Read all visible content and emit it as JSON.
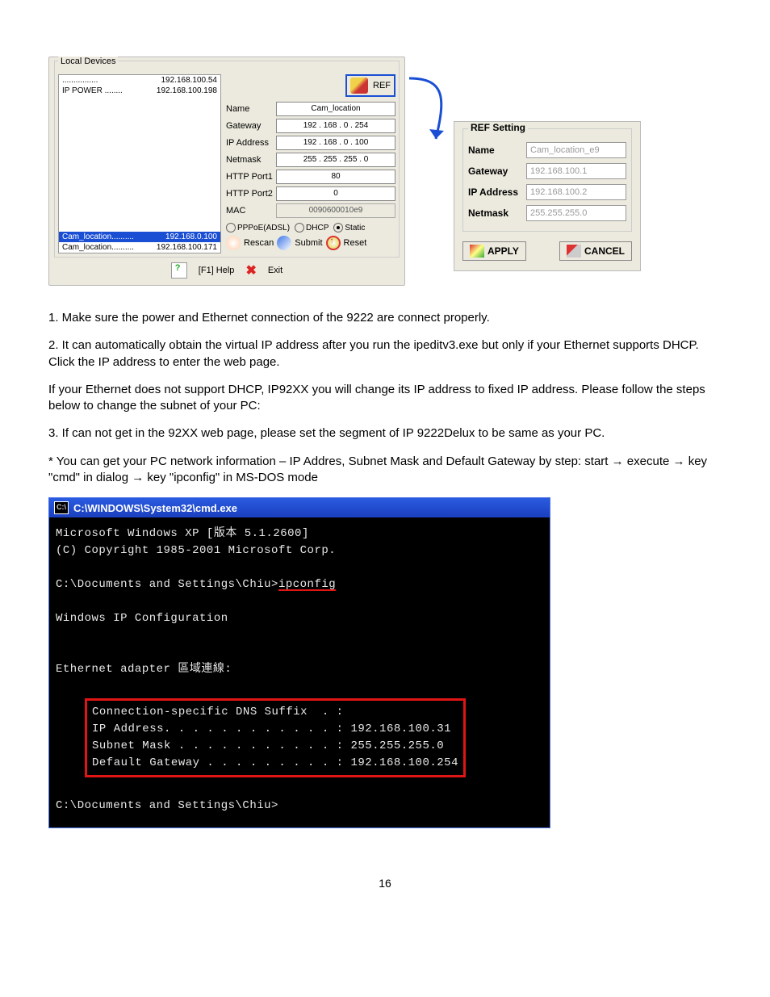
{
  "local_devices": {
    "fieldset_title": "Local Devices",
    "list_top": [
      {
        "name": "................",
        "ip": "192.168.100.54"
      },
      {
        "name": "IP POWER  ........",
        "ip": "192.168.100.198"
      }
    ],
    "list_bottom": [
      {
        "name": "Cam_location..........",
        "ip": "192.168.0.100",
        "selected": true
      },
      {
        "name": "Cam_location..........",
        "ip": "192.168.100.171",
        "selected": false
      }
    ],
    "ref_label": "REF",
    "fields": {
      "name_label": "Name",
      "name_value": "Cam_location",
      "gateway_label": "Gateway",
      "gateway_value": "192 . 168 .   0  . 254",
      "ip_label": "IP Address",
      "ip_value": "192 . 168 .   0  .  100",
      "netmask_label": "Netmask",
      "netmask_value": "255 . 255 . 255 .   0",
      "http1_label": "HTTP Port1",
      "http1_value": "80",
      "http2_label": "HTTP Port2",
      "http2_value": "0",
      "mac_label": "MAC",
      "mac_value": "0090600010e9"
    },
    "radios": {
      "pppoe": "PPPoE(ADSL)",
      "dhcp": "DHCP",
      "static": "Static",
      "selected": "static"
    },
    "actions": {
      "rescan": "Rescan",
      "submit": "Submit",
      "reset": "Reset"
    },
    "bottom": {
      "help": "[F1] Help",
      "exit": "Exit"
    }
  },
  "ref_panel": {
    "title": "REF Setting",
    "rows": {
      "name_label": "Name",
      "name_value": "Cam_location_e9",
      "gateway_label": "Gateway",
      "gateway_value": "192.168.100.1",
      "ip_label": "IP Address",
      "ip_value": "192.168.100.2",
      "netmask_label": "Netmask",
      "netmask_value": "255.255.255.0"
    },
    "buttons": {
      "apply": "APPLY",
      "cancel": "CANCEL"
    }
  },
  "instructions": {
    "p1": "1. Make sure the power and Ethernet connection of the 9222 are connect properly.",
    "p2": "2. It can automatically obtain the virtual IP address after you run the ipeditv3.exe but only if your Ethernet supports DHCP. Click the IP address to enter the web page.",
    "p3": "If your Ethernet does not support DHCP, IP92XX you will change its IP address to fixed IP address. Please follow the steps below to change the subnet of your PC:",
    "p4": "3.  If can not get in the 92XX web page, please set the segment of IP 9222Delux to be same as your PC.",
    "p5_a": "* You can get your PC network information – IP Addres, Subnet Mask and Default Gateway by  step: start ",
    "p5_b": " execute ",
    "p5_c": " key \"cmd\" in dialog ",
    "p5_d": "   key  \"ipconfig\" in MS-DOS mode",
    "arrow": "→"
  },
  "cmd": {
    "icon_text": "C:\\",
    "title": "C:\\WINDOWS\\System32\\cmd.exe",
    "line1": "Microsoft Windows XP [版本 5.1.2600]",
    "line2": "(C) Copyright 1985-2001 Microsoft Corp.",
    "prompt1_a": "C:\\Documents and Settings\\Chiu>",
    "prompt1_b": "ipconfig",
    "heading": "Windows IP Configuration",
    "adapter": "Ethernet adapter 區域連線:",
    "box_l1": "Connection-specific DNS Suffix  . :",
    "box_l2": "IP Address. . . . . . . . . . . . : 192.168.100.31",
    "box_l3": "Subnet Mask . . . . . . . . . . . : 255.255.255.0",
    "box_l4": "Default Gateway . . . . . . . . . : 192.168.100.254",
    "prompt2": "C:\\Documents and Settings\\Chiu>"
  },
  "page_number": "16"
}
